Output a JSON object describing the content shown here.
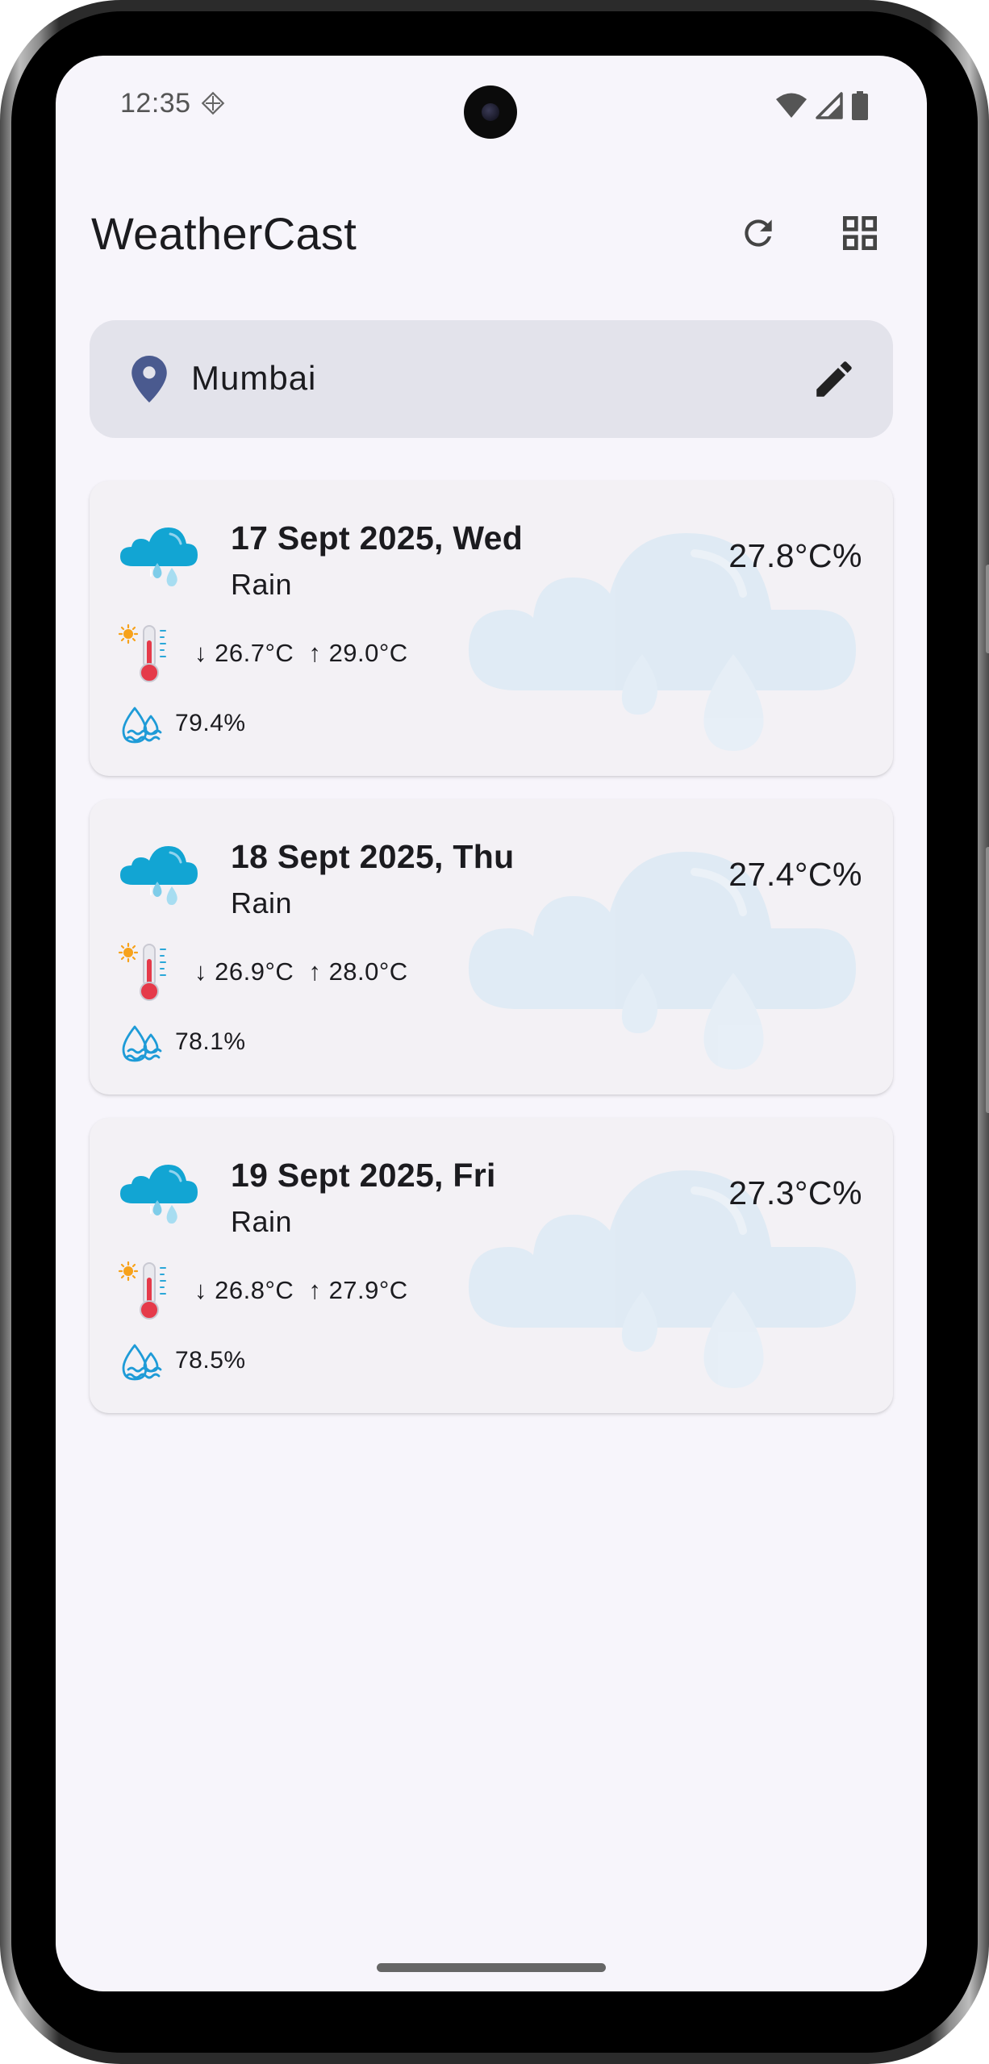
{
  "status_bar": {
    "time": "12:35"
  },
  "app_bar": {
    "title": "WeatherCast",
    "refresh_icon": "refresh-icon",
    "grid_icon": "grid-view-icon"
  },
  "location": {
    "icon": "location-pin-icon",
    "city": "Mumbai",
    "edit_icon": "edit-pencil-icon"
  },
  "forecast": [
    {
      "date": "17 Sept 2025, Wed",
      "condition": "Rain",
      "temp": "27.8°C%",
      "range": "↓ 26.7°C  ↑ 29.0°C",
      "humidity": "79.4%"
    },
    {
      "date": "18 Sept 2025, Thu",
      "condition": "Rain",
      "temp": "27.4°C%",
      "range": "↓ 26.9°C  ↑ 28.0°C",
      "humidity": "78.1%"
    },
    {
      "date": "19 Sept 2025, Fri",
      "condition": "Rain",
      "temp": "27.3°C%",
      "range": "↓ 26.8°C  ↑ 27.9°C",
      "humidity": "78.5%"
    }
  ],
  "colors": {
    "background": "#f7f5fb",
    "card": "#f3f1f5",
    "location_bar": "#e3e3eb",
    "pin": "#4a5a8f",
    "cloud": "#12a5d3",
    "humidity_icon": "#1e9bd7"
  }
}
